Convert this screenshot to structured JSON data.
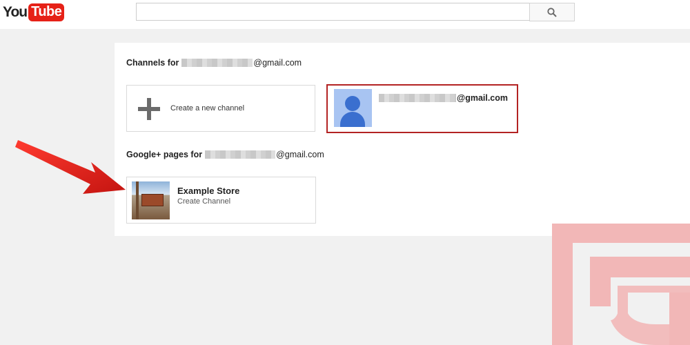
{
  "header": {
    "logo_you": "You",
    "logo_tube": "Tube",
    "search": {
      "value": "",
      "placeholder": ""
    },
    "search_button_icon": "search-icon"
  },
  "channels_section": {
    "title": "Channels for",
    "email_domain": "@gmail.com"
  },
  "create_card": {
    "icon": "plus-icon",
    "label": "Create a new channel"
  },
  "account_card": {
    "email_domain": "@gmail.com",
    "selected_border_color": "#b32222"
  },
  "pages_section": {
    "title": "Google+ pages for",
    "email_domain": "@gmail.com"
  },
  "store_card": {
    "name": "Example Store",
    "action": "Create Channel"
  },
  "colors": {
    "brand_red": "#e62117",
    "arrow_red": "#e01b14",
    "watermark": "#f2b7b7"
  }
}
